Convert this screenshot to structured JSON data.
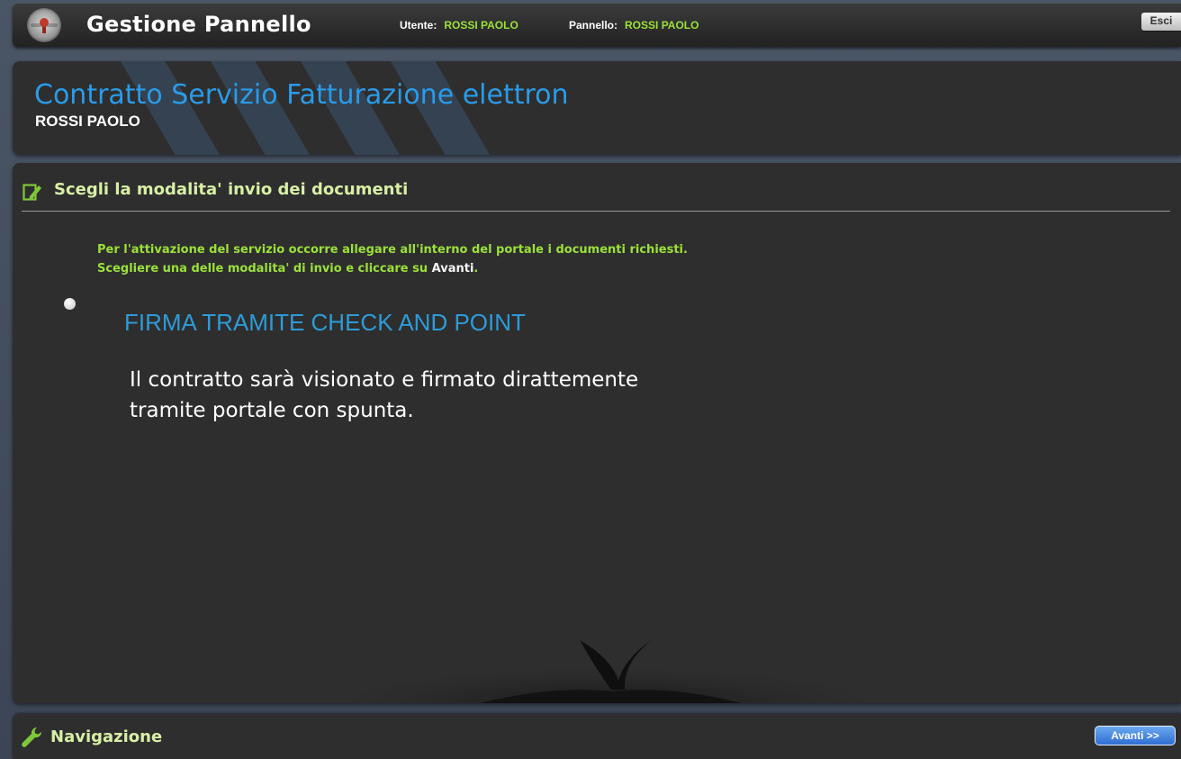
{
  "topbar": {
    "app_title": "Gestione Pannello",
    "user_label": "Utente:",
    "user_value": "ROSSI PAOLO",
    "panel_label": "Pannello:",
    "panel_value": "ROSSI PAOLO",
    "exit_label": "Esci"
  },
  "header": {
    "title": "Contratto Servizio Fatturazione elettron",
    "subtitle": "ROSSI PAOLO"
  },
  "main": {
    "section_title": "Scegli la modalita' invio dei documenti",
    "intro_line1": "Per l'attivazione del servizio occorre allegare all'interno del portale i documenti richiesti.",
    "intro_line2_prefix": "Scegliere una delle modalita' di invio e cliccare su ",
    "intro_line2_bold": "Avanti",
    "intro_line2_suffix": ".",
    "option": {
      "title": "FIRMA TRAMITE CHECK AND POINT",
      "description_line1": "Il contratto sarà visionato e firmato dirattemente",
      "description_line2": "tramite portale con spunta."
    }
  },
  "navigation": {
    "label": "Navigazione",
    "next_label": "Avanti >>"
  },
  "colors": {
    "accent_blue": "#2a9be8",
    "accent_green": "#9be03a",
    "panel_bg": "#2e2e2e"
  }
}
